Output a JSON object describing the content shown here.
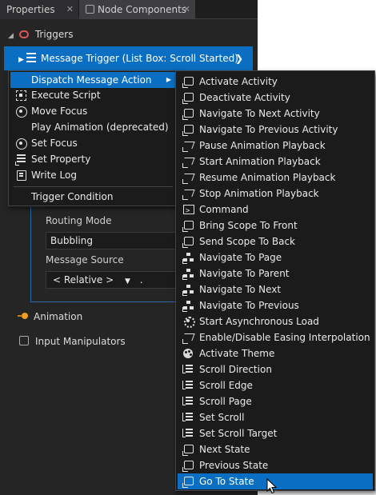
{
  "tabs": [
    {
      "label": "Properties"
    },
    {
      "label": "Node Components"
    }
  ],
  "close_glyph": "✕",
  "tree": {
    "triggers_label": "Triggers",
    "message_trigger_label": "Message Trigger (List Box: Scroll Started)"
  },
  "properties": {
    "routing_mode_label": "Routing Mode",
    "routing_mode_value": "Bubbling",
    "message_source_label": "Message Source",
    "message_source_value": "< Relative >",
    "message_source_suffix": "."
  },
  "sections": {
    "animation_label": "Animation",
    "input_manipulators_label": "Input Manipulators"
  },
  "menu": {
    "items": [
      {
        "label": "Dispatch Message Action",
        "icon": "none",
        "submenu": true
      },
      {
        "label": "Execute Script",
        "icon": "script-icon"
      },
      {
        "label": "Move Focus",
        "icon": "target-icon"
      },
      {
        "label": "Play Animation (deprecated)",
        "icon": "none"
      },
      {
        "label": "Set Focus",
        "icon": "target-icon"
      },
      {
        "label": "Set Property",
        "icon": "list-icon"
      },
      {
        "label": "Write Log",
        "icon": "pen-icon"
      }
    ],
    "trigger_condition_label": "Trigger Condition"
  },
  "submenu": {
    "items": [
      {
        "label": "Activate Activity",
        "icon": "box"
      },
      {
        "label": "Deactivate Activity",
        "icon": "box"
      },
      {
        "label": "Navigate To Next Activity",
        "icon": "box"
      },
      {
        "label": "Navigate To Previous Activity",
        "icon": "box"
      },
      {
        "label": "Pause Animation Playback",
        "icon": "wave"
      },
      {
        "label": "Start Animation Playback",
        "icon": "wave"
      },
      {
        "label": "Resume Animation Playback",
        "icon": "wave"
      },
      {
        "label": "Stop Animation Playback",
        "icon": "wave"
      },
      {
        "label": "Command",
        "icon": "cmd"
      },
      {
        "label": "Bring Scope To Front",
        "icon": "box"
      },
      {
        "label": "Send Scope To Back",
        "icon": "box"
      },
      {
        "label": "Navigate To Page",
        "icon": "tree"
      },
      {
        "label": "Navigate To Parent",
        "icon": "tree"
      },
      {
        "label": "Navigate To Next",
        "icon": "tree"
      },
      {
        "label": "Navigate To Previous",
        "icon": "tree"
      },
      {
        "label": "Start Asynchronous Load",
        "icon": "gear"
      },
      {
        "label": "Enable/Disable Easing Interpolation",
        "icon": "wave"
      },
      {
        "label": "Activate Theme",
        "icon": "theme"
      },
      {
        "label": "Scroll Direction",
        "icon": "lines"
      },
      {
        "label": "Scroll Edge",
        "icon": "lines"
      },
      {
        "label": "Scroll Page",
        "icon": "lines"
      },
      {
        "label": "Set Scroll",
        "icon": "lines"
      },
      {
        "label": "Set Scroll Target",
        "icon": "lines"
      },
      {
        "label": "Next State",
        "icon": "box"
      },
      {
        "label": "Previous State",
        "icon": "box"
      },
      {
        "label": "Go To State",
        "icon": "box"
      }
    ]
  },
  "colors": {
    "accent": "#0a6fc2",
    "panel_bg": "#252526",
    "menu_bg": "#1b1b1c"
  }
}
